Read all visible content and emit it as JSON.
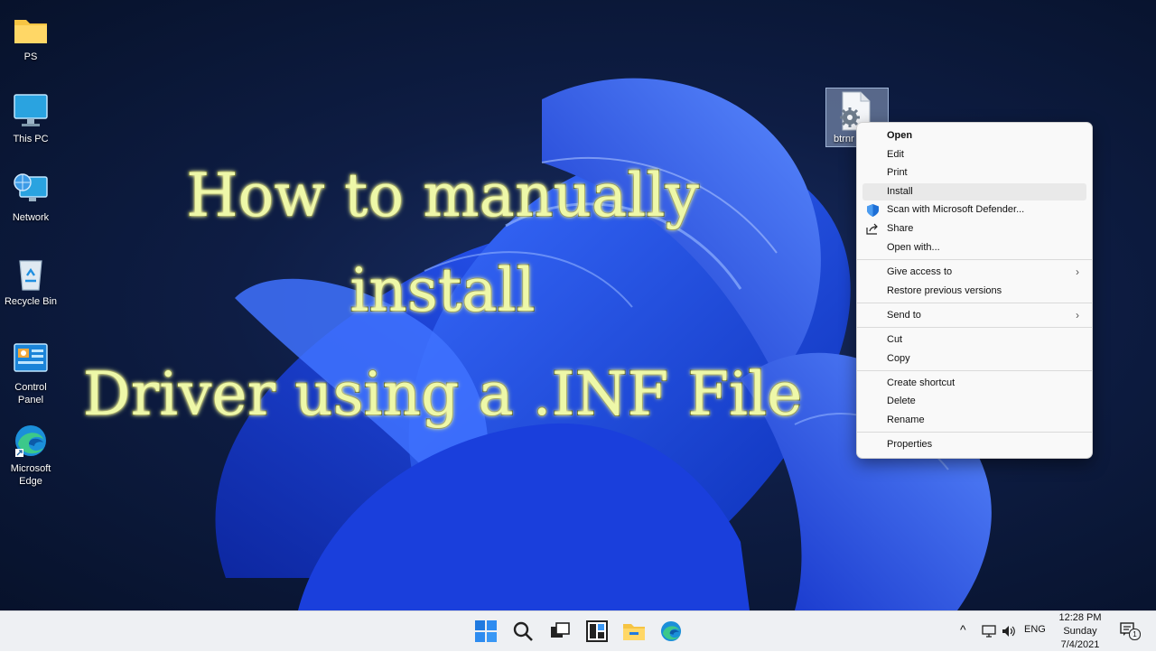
{
  "desktop_icons": [
    {
      "label": "PS",
      "icon": "folder-icon"
    },
    {
      "label": "This PC",
      "icon": "monitor-icon"
    },
    {
      "label": "Network",
      "icon": "network-icon"
    },
    {
      "label": "Recycle Bin",
      "icon": "recycle-bin-icon"
    },
    {
      "label": "Control\nPanel",
      "icon": "control-panel-icon"
    },
    {
      "label": "Microsoft\nEdge",
      "icon": "edge-icon"
    }
  ],
  "headline": {
    "line1": "How to manually",
    "line2": "install",
    "line3": "Driver using a .INF File"
  },
  "selected_file": {
    "label": "btrnr",
    "icon": "inf-gear-file-icon"
  },
  "context_menu": {
    "items": [
      {
        "label": "Open",
        "bold": true
      },
      {
        "label": "Edit"
      },
      {
        "label": "Print"
      },
      {
        "label": "Install",
        "highlighted": true
      },
      {
        "label": "Scan with Microsoft Defender...",
        "icon": "defender-shield-icon"
      },
      {
        "label": "Share",
        "icon": "share-icon"
      },
      {
        "label": "Open with..."
      },
      {
        "label": "Give access to",
        "submenu": true
      },
      {
        "label": "Restore previous versions"
      },
      {
        "label": "Send to",
        "submenu": true
      },
      {
        "label": "Cut"
      },
      {
        "label": "Copy"
      },
      {
        "label": "Create shortcut"
      },
      {
        "label": "Delete"
      },
      {
        "label": "Rename"
      },
      {
        "label": "Properties"
      }
    ]
  },
  "taskbar": {
    "apps": [
      "start-icon",
      "search-icon",
      "task-view-icon",
      "widgets-icon",
      "file-explorer-icon",
      "edge-icon"
    ],
    "tray": {
      "chevron": "^",
      "lang": "ENG",
      "time": "12:28 PM",
      "day": "Sunday",
      "date": "7/4/2021",
      "notif_count": "1"
    }
  },
  "colors": {
    "accent": "#0078d4",
    "headline_fill": "#eef8a8",
    "menu_bg": "#f9f9f9"
  }
}
